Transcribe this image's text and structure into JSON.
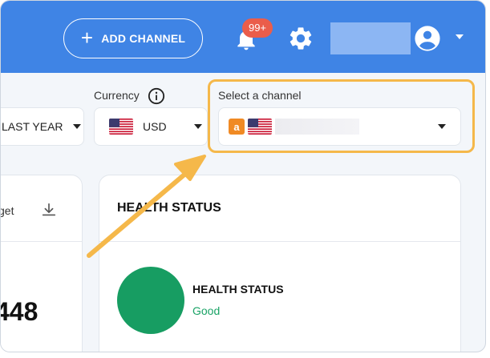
{
  "topbar": {
    "add_channel_label": "ADD CHANNEL",
    "notifications_badge": "99+",
    "accent_color": "#3f84e5"
  },
  "filters": {
    "period_value": "LAST YEAR",
    "currency_label": "Currency",
    "currency_value": "USD",
    "channel_label": "Select a channel"
  },
  "left_card": {
    "partial_text": "get",
    "value": "448"
  },
  "health": {
    "section_title": "HEALTH STATUS",
    "item_title": "HEALTH STATUS",
    "status": "Good",
    "status_color": "#1aa366"
  },
  "icons": [
    "plus-icon",
    "bell-icon",
    "gear-icon",
    "account-circle-icon",
    "info-icon",
    "download-icon",
    "amazon-icon",
    "us-flag-icon"
  ]
}
